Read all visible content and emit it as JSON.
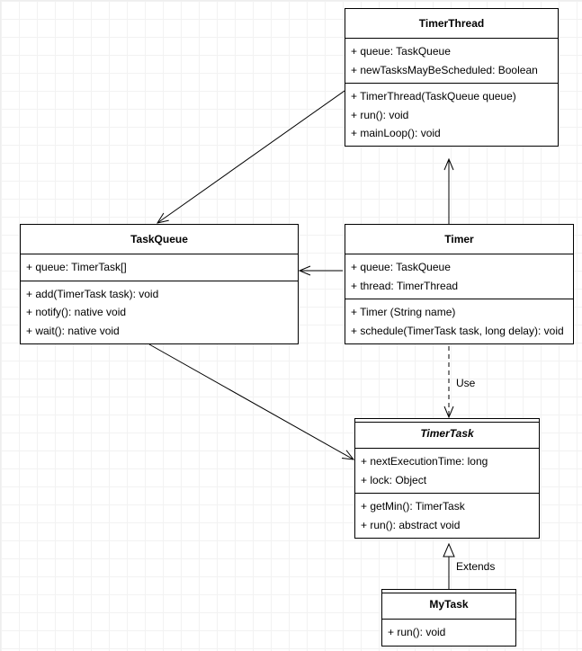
{
  "classes": {
    "timerThread": {
      "name": "TimerThread",
      "attrs": [
        "+ queue: TaskQueue",
        "+ newTasksMayBeScheduled: Boolean"
      ],
      "ops": [
        "+ TimerThread(TaskQueue queue)",
        "+ run(): void",
        "+ mainLoop(): void"
      ]
    },
    "taskQueue": {
      "name": "TaskQueue",
      "attrs": [
        "+ queue: TimerTask[]"
      ],
      "ops": [
        "+ add(TimerTask task): void",
        "+ notify(): native void",
        "+ wait(): native void"
      ]
    },
    "timer": {
      "name": "Timer",
      "attrs": [
        "+ queue: TaskQueue",
        "+ thread: TimerThread"
      ],
      "ops": [
        "+ Timer (String name)",
        "+ schedule(TimerTask task, long delay): void"
      ]
    },
    "timerTask": {
      "name": "TimerTask",
      "attrs": [
        "+ nextExecutionTime: long",
        "+ lock: Object"
      ],
      "ops": [
        "+ getMin(): TimerTask",
        "+ run(): abstract void"
      ]
    },
    "myTask": {
      "name": "MyTask",
      "ops": [
        "+ run(): void"
      ]
    }
  },
  "labels": {
    "use": "Use",
    "extends": "Extends"
  }
}
